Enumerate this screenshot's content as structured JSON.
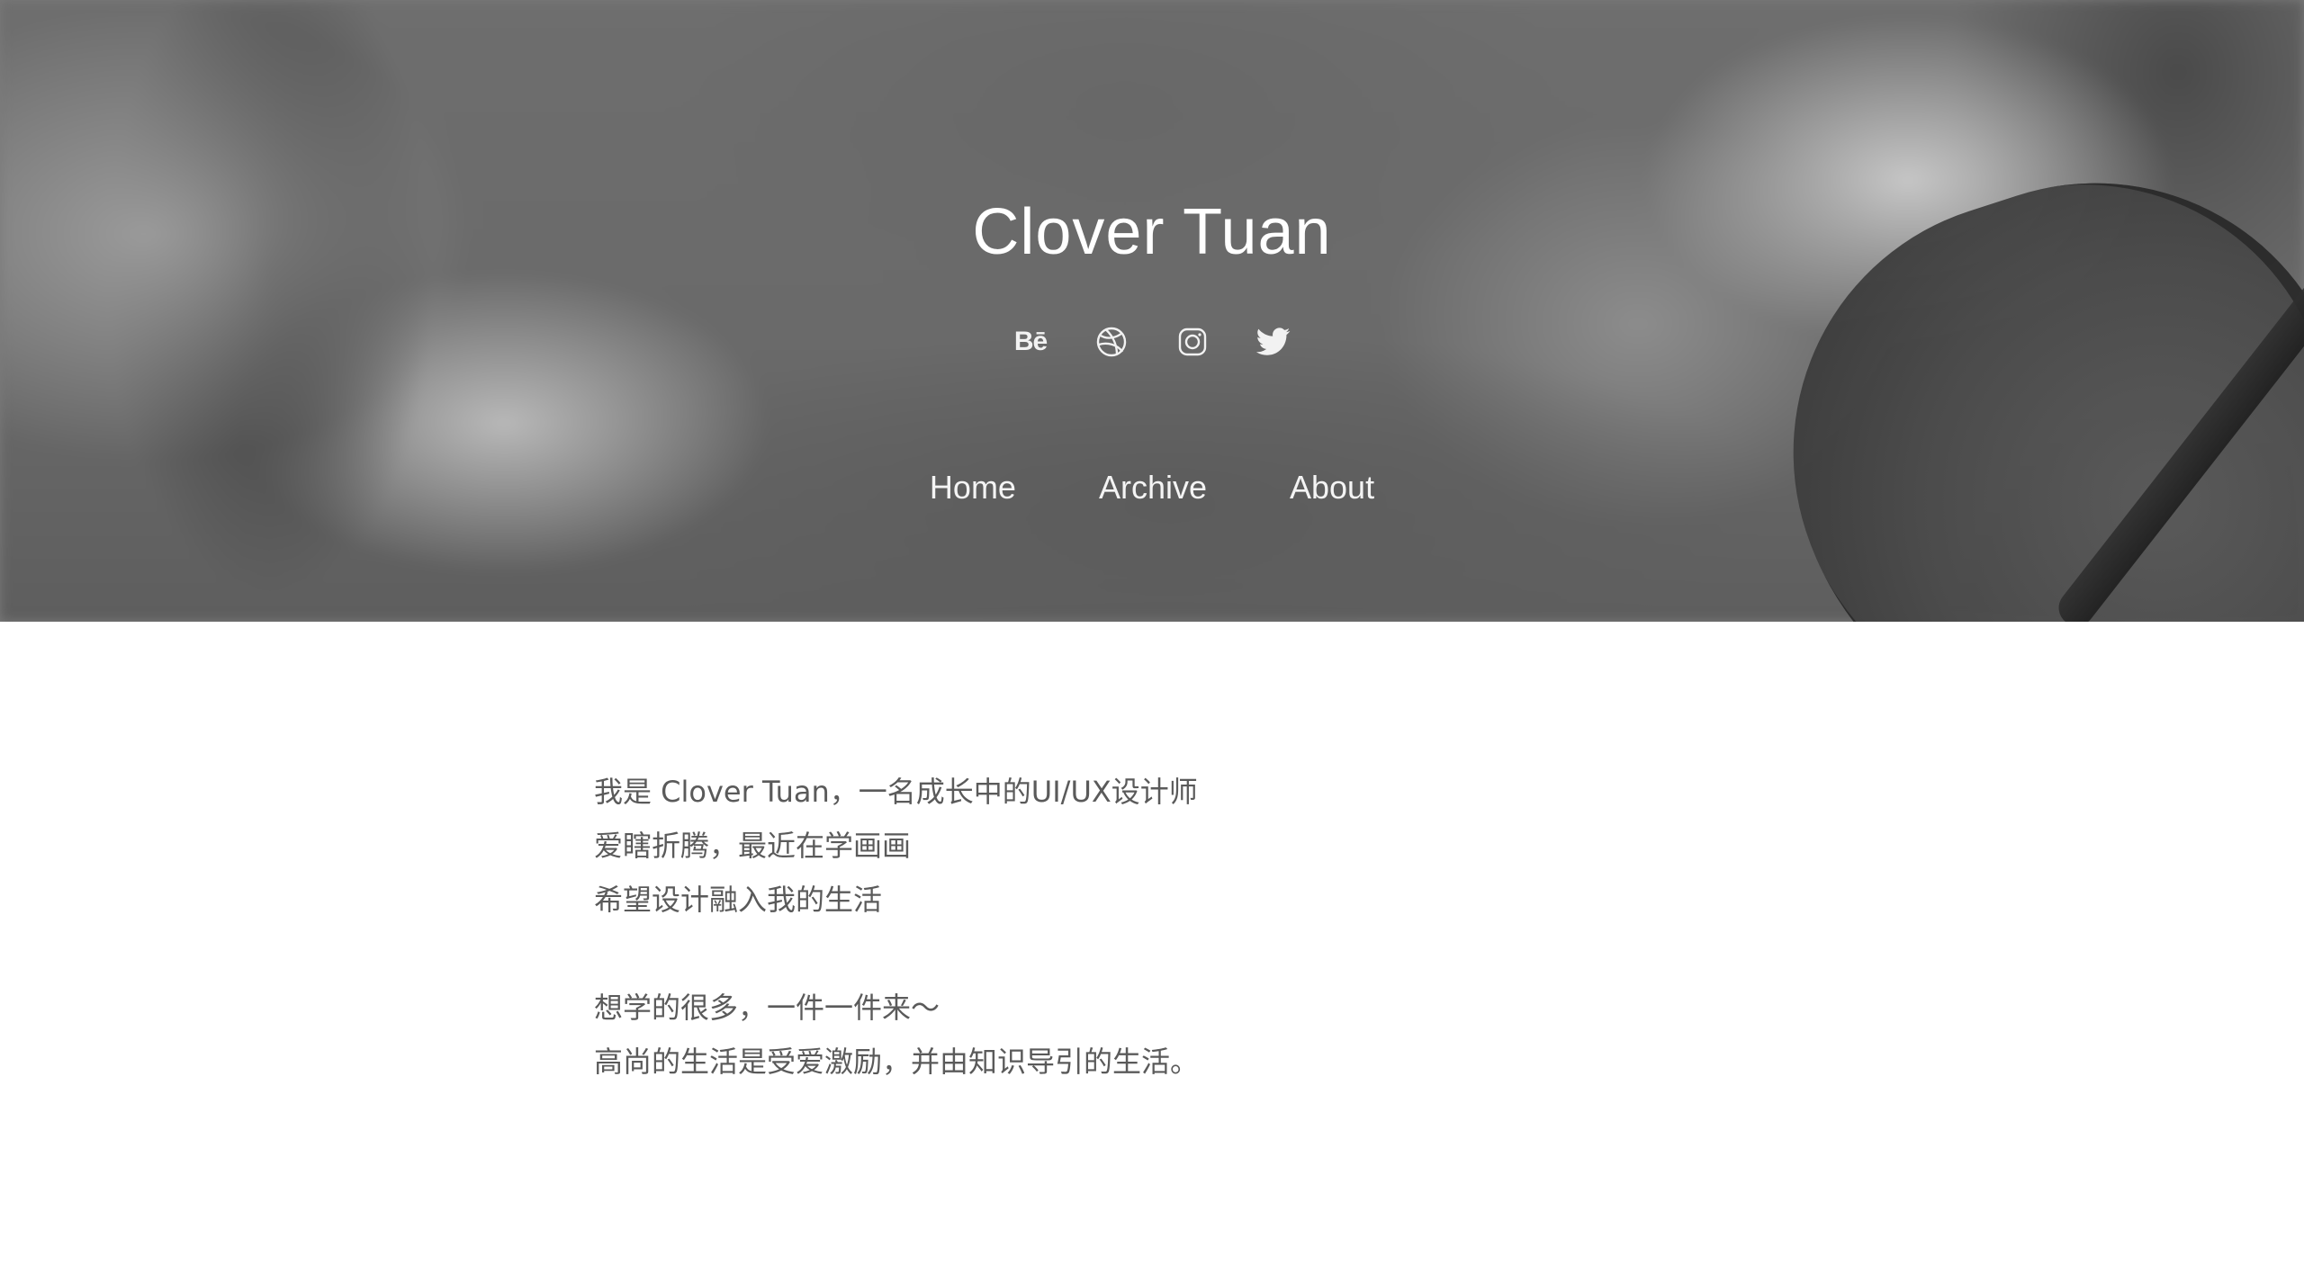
{
  "header": {
    "site_title": "Clover Tuan",
    "social_links": [
      {
        "icon": "behance-icon",
        "glyph": "Bē"
      },
      {
        "icon": "dribbble-icon"
      },
      {
        "icon": "instagram-icon"
      },
      {
        "icon": "twitter-icon"
      }
    ],
    "nav": {
      "home": "Home",
      "archive": "Archive",
      "about": "About"
    }
  },
  "about": {
    "lines_block1": [
      "我是 Clover Tuan，一名成长中的UI/UX设计师",
      "爱瞎折腾，最近在学画画",
      "希望设计融入我的生活"
    ],
    "lines_block2": [
      "想学的很多，一件一件来～",
      "高尚的生活是受爱激励，并由知识导引的生活。"
    ]
  },
  "colors": {
    "body_text": "#5a5a5a",
    "hero_text": "#ffffff"
  }
}
